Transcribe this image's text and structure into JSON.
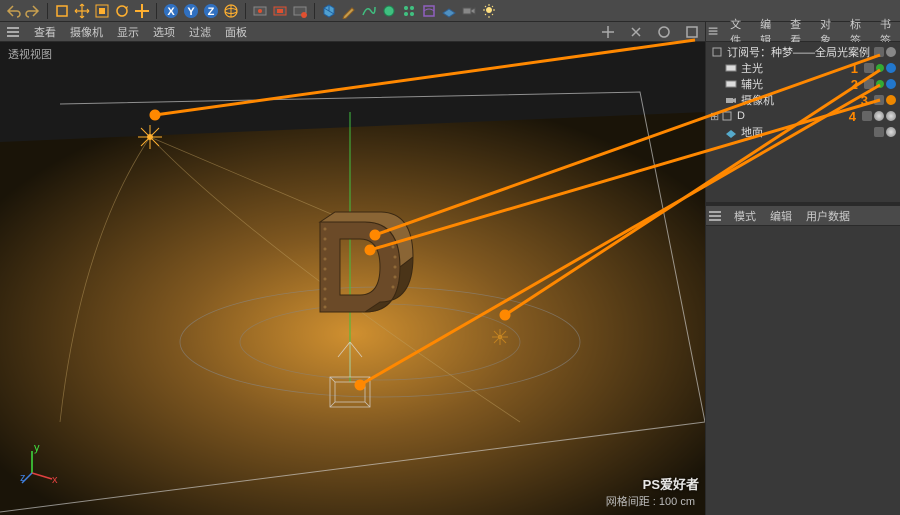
{
  "toolbar": {
    "icons": [
      "undo",
      "redo",
      "live",
      "move",
      "scale",
      "rotate",
      "last",
      "x-axis",
      "y-axis",
      "z-axis",
      "world",
      "render",
      "region",
      "irr",
      "cube",
      "pen",
      "spline",
      "nurbs",
      "array",
      "deformer",
      "floor",
      "camera",
      "light"
    ]
  },
  "viewMenu": {
    "items": [
      "查看",
      "摄像机",
      "显示",
      "选项",
      "过滤",
      "面板"
    ]
  },
  "viewport": {
    "label": "透视视图",
    "gridInfo": "网格间距 : 100 cm",
    "watermark": "PS爱好者"
  },
  "objectPanel": {
    "tabs": [
      "文件",
      "编辑",
      "查看",
      "对象",
      "标签",
      "书签"
    ],
    "tree": [
      {
        "indent": 0,
        "icon": "null",
        "label": "订阅号：种梦——全局光案例",
        "num": "",
        "tags": [
          "grey",
          "dot"
        ]
      },
      {
        "indent": 1,
        "icon": "light",
        "label": "主光",
        "num": "1",
        "tags": [
          "grey",
          "green",
          "target"
        ]
      },
      {
        "indent": 1,
        "icon": "light",
        "label": "辅光",
        "num": "2",
        "tags": [
          "grey",
          "green",
          "target"
        ]
      },
      {
        "indent": 1,
        "icon": "camera",
        "label": "摄像机",
        "num": "3",
        "tags": [
          "grey",
          "orange"
        ]
      },
      {
        "indent": 0,
        "icon": "null",
        "label": "D",
        "num": "4",
        "tags": [
          "grey",
          "mat",
          "mat"
        ]
      },
      {
        "indent": 1,
        "icon": "plane",
        "label": "地面",
        "num": "",
        "tags": [
          "grey",
          "mat"
        ]
      }
    ]
  },
  "attrPanel": {
    "tabs": [
      "模式",
      "编辑",
      "用户数据"
    ]
  }
}
